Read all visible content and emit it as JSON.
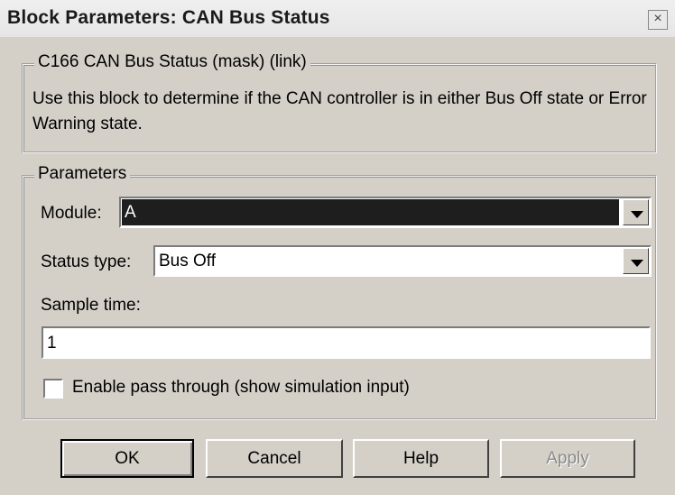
{
  "window": {
    "title": "Block Parameters: CAN Bus Status",
    "close_glyph": "×"
  },
  "mask_group": {
    "legend": "C166 CAN Bus Status (mask) (link)",
    "description": "Use this block to determine if the CAN controller is in either Bus Off state or Error Warning state."
  },
  "parameters": {
    "legend": "Parameters",
    "module_label": "Module:",
    "module_value": "A",
    "status_type_label": "Status type:",
    "status_type_value": "Bus Off",
    "sample_time_label": "Sample time:",
    "sample_time_value": "1",
    "pass_through_label": "Enable pass through (show simulation input)",
    "pass_through_checked": false
  },
  "buttons": {
    "ok": "OK",
    "cancel": "Cancel",
    "help": "Help",
    "apply": "Apply"
  }
}
